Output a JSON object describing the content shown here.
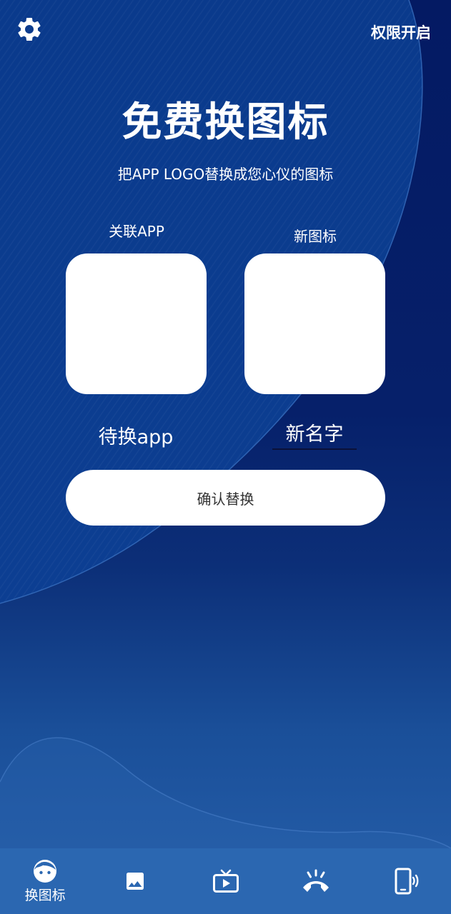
{
  "header": {
    "settings_icon": "gear-icon",
    "permission_label": "权限开启"
  },
  "main": {
    "title": "免费换图标",
    "subtitle": "把APP LOGO替换成您心仪的图标",
    "linked_app_label": "关联APP",
    "new_icon_label": "新图标",
    "pending_app_text": "待换app",
    "new_name_placeholder": "新名字",
    "confirm_label": "确认替换"
  },
  "bottom_nav": {
    "items": [
      {
        "icon": "face-icon",
        "label": "换图标",
        "active": true
      },
      {
        "icon": "image-icon",
        "label": ""
      },
      {
        "icon": "tv-icon",
        "label": ""
      },
      {
        "icon": "phone-icon",
        "label": ""
      },
      {
        "icon": "vibrate-phone-icon",
        "label": ""
      }
    ]
  },
  "colors": {
    "background_top": "#041a63",
    "background_bottom": "#2760ab",
    "nav_bar": "#2b67b1",
    "card": "#ffffff"
  }
}
